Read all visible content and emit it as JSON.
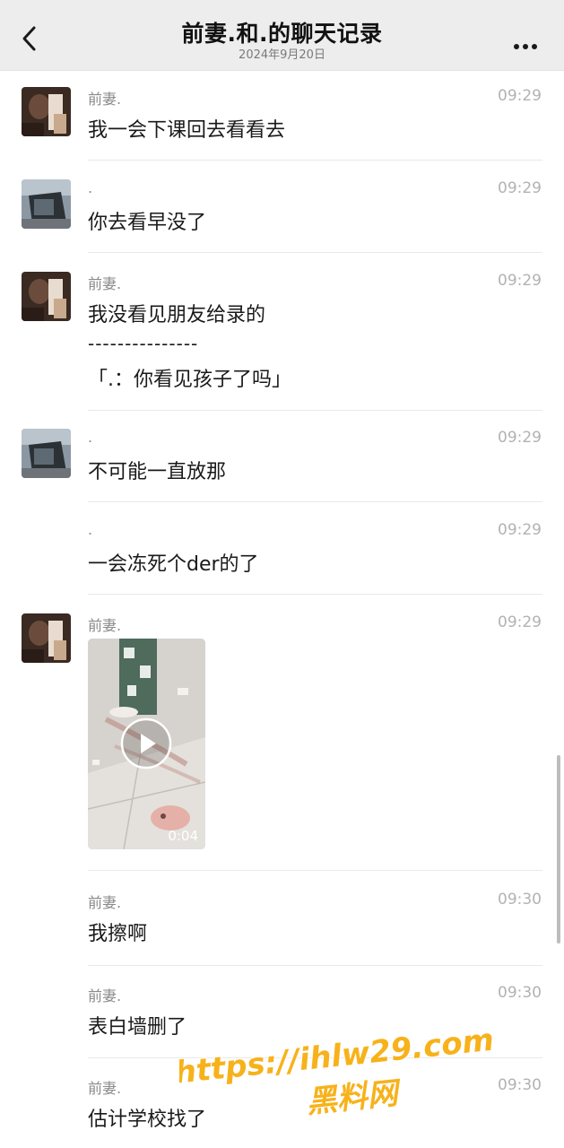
{
  "header": {
    "title": "前妻.和.的聊天记录",
    "date": "2024年9月20日",
    "back_icon": "chevron-left-icon",
    "more_icon": "more-dots-icon"
  },
  "messages": [
    {
      "sender": "前妻.",
      "time": "09:29",
      "text": "我一会下课回去看看去",
      "avatar": "ex-wife"
    },
    {
      "sender": ".",
      "time": "09:29",
      "text": "你去看早没了",
      "avatar": "car"
    },
    {
      "sender": "前妻.",
      "time": "09:29",
      "text": "我没看见朋友给录的",
      "divider_text": "---------------",
      "quote_text": "「.：你看见孩子了吗」",
      "avatar": "ex-wife"
    },
    {
      "sender": ".",
      "time": "09:29",
      "text": "不可能一直放那",
      "avatar": "car"
    },
    {
      "sender": ".",
      "time": "09:29",
      "text": "一会冻死个der的了",
      "avatar": "none"
    },
    {
      "sender": "前妻.",
      "time": "09:29",
      "video_duration": "0:04",
      "avatar": "ex-wife"
    },
    {
      "sender": "前妻.",
      "time": "09:30",
      "text": "我擦啊",
      "avatar": "none"
    },
    {
      "sender": "前妻.",
      "time": "09:30",
      "text": "表白墙删了",
      "avatar": "none"
    },
    {
      "sender": "前妻.",
      "time": "09:30",
      "text": "估计学校找了",
      "avatar": "none"
    }
  ],
  "watermark": {
    "line1": "https://ihlw29.com",
    "line2": "黑料网",
    "color": "#f7b21b"
  },
  "colors": {
    "header_bg": "#ededed",
    "time_gray": "#b2b2b2",
    "sender_gray": "#8a8a8a"
  }
}
